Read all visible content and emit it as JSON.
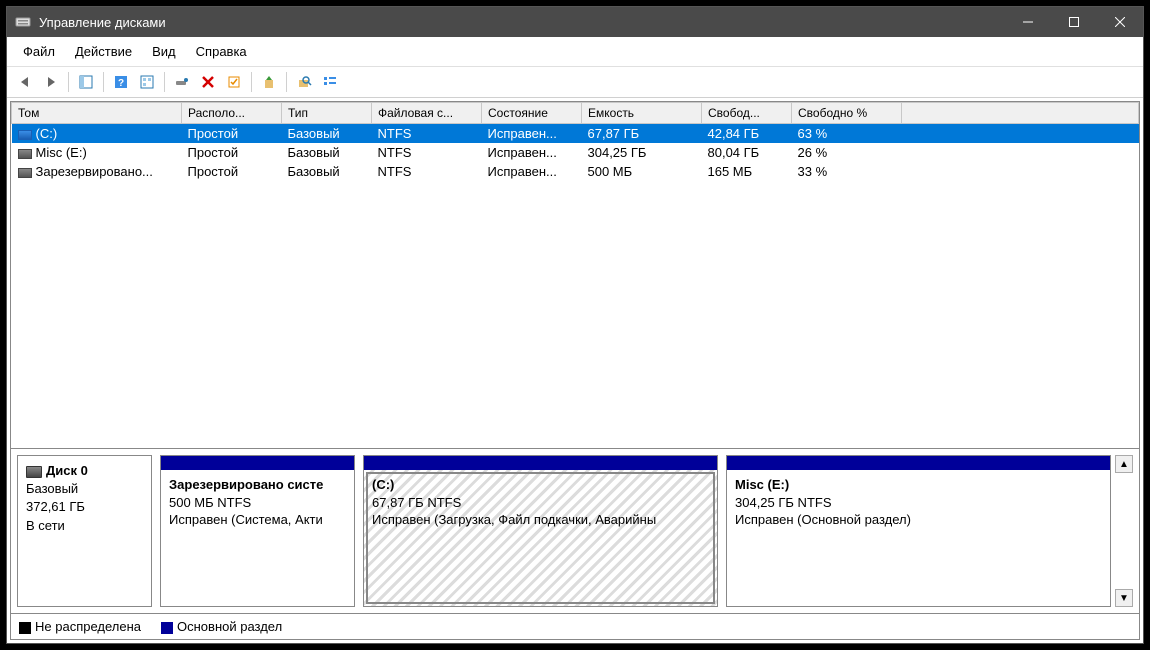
{
  "window": {
    "title": "Управление дисками"
  },
  "menubar": {
    "file": "Файл",
    "action": "Действие",
    "view": "Вид",
    "help": "Справка"
  },
  "columns": {
    "volume": "Том",
    "layout": "Располо...",
    "type": "Тип",
    "filesystem": "Файловая с...",
    "status": "Состояние",
    "capacity": "Емкость",
    "free": "Свобод...",
    "free_pct": "Свободно %"
  },
  "volumes": [
    {
      "name": "(C:)",
      "layout": "Простой",
      "type": "Базовый",
      "fs": "NTFS",
      "status": "Исправен...",
      "capacity": "67,87 ГБ",
      "free": "42,84 ГБ",
      "pct": "63 %",
      "selected": true
    },
    {
      "name": "Misc (E:)",
      "layout": "Простой",
      "type": "Базовый",
      "fs": "NTFS",
      "status": "Исправен...",
      "capacity": "304,25 ГБ",
      "free": "80,04 ГБ",
      "pct": "26 %",
      "selected": false
    },
    {
      "name": "Зарезервировано...",
      "layout": "Простой",
      "type": "Базовый",
      "fs": "NTFS",
      "status": "Исправен...",
      "capacity": "500 МБ",
      "free": "165 МБ",
      "pct": "33 %",
      "selected": false
    }
  ],
  "disk": {
    "label": "Диск 0",
    "type": "Базовый",
    "size": "372,61 ГБ",
    "online": "В сети"
  },
  "partitions": {
    "p0": {
      "title": "Зарезервировано систе",
      "line2": "500 МБ NTFS",
      "line3": "Исправен (Система, Акти"
    },
    "p1": {
      "title": "(C:)",
      "line2": "67,87 ГБ NTFS",
      "line3": "Исправен (Загрузка, Файл подкачки, Аварийны"
    },
    "p2": {
      "title": "Misc  (E:)",
      "line2": "304,25 ГБ NTFS",
      "line3": "Исправен (Основной раздел)"
    }
  },
  "legend": {
    "unallocated": "Не распределена",
    "primary": "Основной раздел"
  }
}
